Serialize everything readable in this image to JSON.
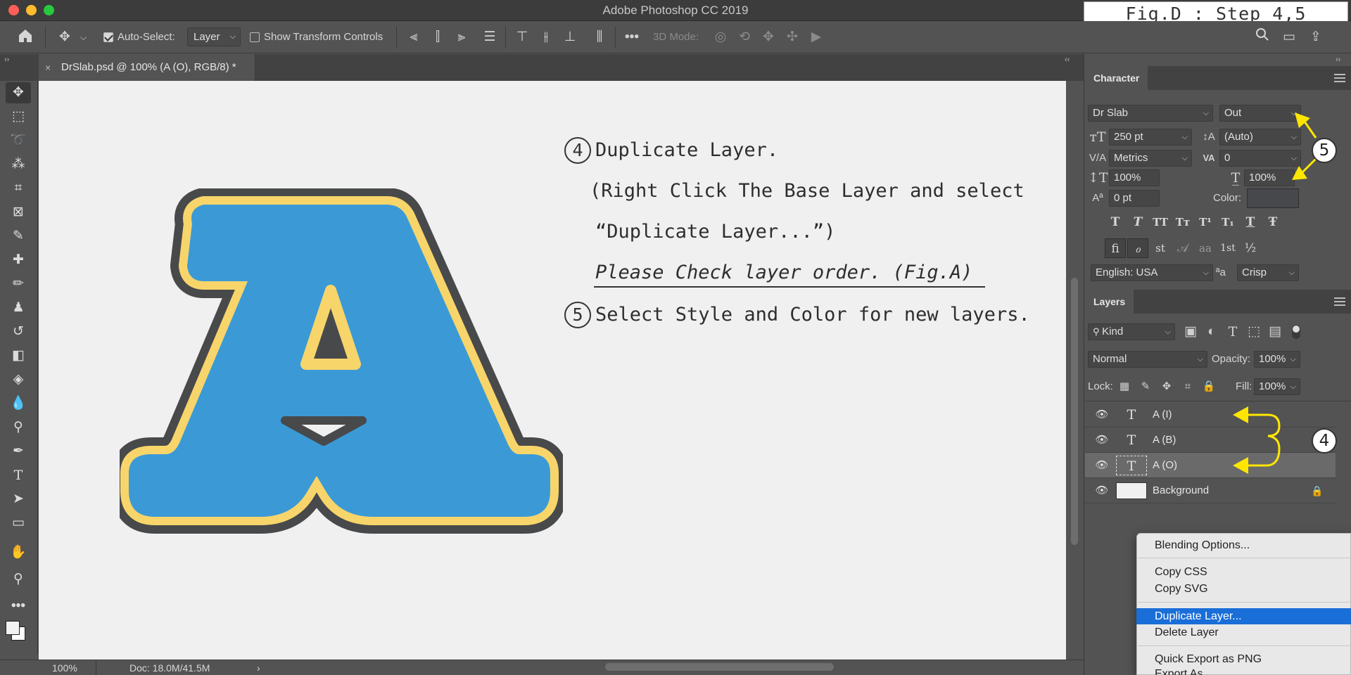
{
  "window": {
    "title": "Adobe Photoshop CC 2019",
    "traffic_colors": [
      "#ff5f56",
      "#ffbd2e",
      "#27c93f"
    ]
  },
  "figure_label": "Fig.D : Step 4,5",
  "options_bar": {
    "auto_select_label": "Auto-Select:",
    "auto_select_checked": true,
    "auto_select_value": "Layer",
    "show_transform_label": "Show Transform Controls",
    "show_transform_checked": false,
    "mode_3d_label": "3D Mode:"
  },
  "document_tab": {
    "title": "DrSlab.psd @ 100% (A (O), RGB/8) *",
    "close": "×"
  },
  "tools": [
    "move-tool",
    "marquee-tool",
    "lasso-tool",
    "quick-select-tool",
    "crop-tool",
    "frame-tool",
    "eyedropper-tool",
    "healing-tool",
    "brush-tool",
    "stamp-tool",
    "history-brush-tool",
    "eraser-tool",
    "bucket-tool",
    "blur-tool",
    "dodge-tool",
    "pen-tool",
    "type-tool",
    "path-select-tool",
    "rectangle-tool",
    "hand-tool",
    "zoom-tool",
    "more-tools"
  ],
  "instructions": {
    "step4_num": "4",
    "step4_title": "Duplicate Layer.",
    "step4_line2": "(Right Click The Base Layer and select",
    "step4_line3": "“Duplicate Layer...”)",
    "step4_note": "Please Check layer order. (Fig.A)",
    "step5_num": "5",
    "step5_title": "Select Style and Color for new layers."
  },
  "artwork": {
    "letter": "A",
    "fill_color": "#3b9ad6",
    "outline_inner_color": "#f7d56b",
    "outline_outer_color": "#48494b"
  },
  "status_bar": {
    "zoom": "100%",
    "doc_info": "Doc: 18.0M/41.5M",
    "arrow": "›"
  },
  "character_panel": {
    "tab": "Character",
    "font_family": "Dr Slab",
    "font_style": "Out",
    "font_size": "250 pt",
    "leading": "(Auto)",
    "kerning": "Metrics",
    "tracking": "0",
    "vertical_scale": "100%",
    "horizontal_scale": "100%",
    "baseline_shift": "0 pt",
    "color_label": "Color:",
    "color_value": "#46484b",
    "style_buttons": [
      "T",
      "T",
      "TT",
      "Tᴛ",
      "T¹",
      "T₁",
      "T",
      "Ŧ"
    ],
    "opentype_buttons": [
      "ﬁ",
      "ℴ",
      "st",
      "𝒜",
      "aa",
      "1st",
      "½"
    ],
    "language": "English: USA",
    "aa_label": "ªa",
    "antialias": "Crisp"
  },
  "layers_panel": {
    "tab": "Layers",
    "filter_kind": "Kind",
    "blend_mode": "Normal",
    "opacity_label": "Opacity:",
    "opacity_value": "100%",
    "lock_label": "Lock:",
    "fill_label": "Fill:",
    "fill_value": "100%",
    "layers": [
      {
        "name": "A (I)",
        "type": "text",
        "selected": false
      },
      {
        "name": "A (B)",
        "type": "text",
        "selected": false
      },
      {
        "name": "A (O)",
        "type": "text",
        "selected": true
      },
      {
        "name": "Background",
        "type": "image",
        "selected": false,
        "locked": true
      }
    ]
  },
  "context_menu": {
    "items": [
      {
        "label": "Blending Options...",
        "highlighted": false
      },
      {
        "label": "Copy CSS",
        "highlighted": false
      },
      {
        "label": "Copy SVG",
        "highlighted": false
      },
      {
        "label": "Duplicate Layer...",
        "highlighted": true
      },
      {
        "label": "Delete Layer",
        "highlighted": false
      },
      {
        "label": "Quick Export as PNG",
        "highlighted": false
      },
      {
        "label": "Export As...",
        "highlighted": false
      }
    ]
  },
  "annotations": {
    "badge4": "4",
    "badge5": "5",
    "arrow_color": "#ffe600"
  }
}
